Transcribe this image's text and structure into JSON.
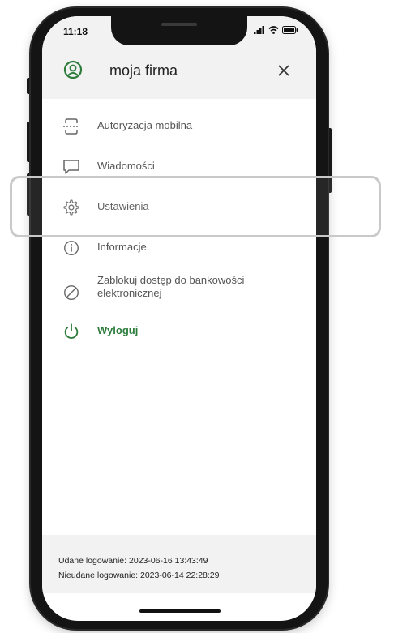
{
  "status_bar": {
    "time": "11:18",
    "icons": [
      "signal-icon",
      "wifi-icon",
      "battery-icon"
    ]
  },
  "header": {
    "title": "moja firma",
    "profile_icon": "user-circle-icon",
    "close_icon": "close-icon"
  },
  "menu": {
    "items": [
      {
        "label": "Autoryzacja mobilna",
        "icon": "mobile-authorization-icon"
      },
      {
        "label": "Wiadomości",
        "icon": "message-icon"
      },
      {
        "label": "Ustawienia",
        "icon": "gear-icon"
      },
      {
        "label": "Informacje",
        "icon": "info-icon"
      },
      {
        "label": "Zablokuj dostęp do bankowości elektronicznej",
        "icon": "block-icon"
      },
      {
        "label": "Wyloguj",
        "icon": "power-icon"
      }
    ]
  },
  "footer": {
    "success_login": "Udane logowanie: 2023-06-16 13:43:49",
    "failed_login": "Nieudane logowanie: 2023-06-14 22:28:29"
  },
  "colors": {
    "accent": "#2e7d3d",
    "header_bg": "#f2f2f2",
    "text_muted": "#555555"
  }
}
